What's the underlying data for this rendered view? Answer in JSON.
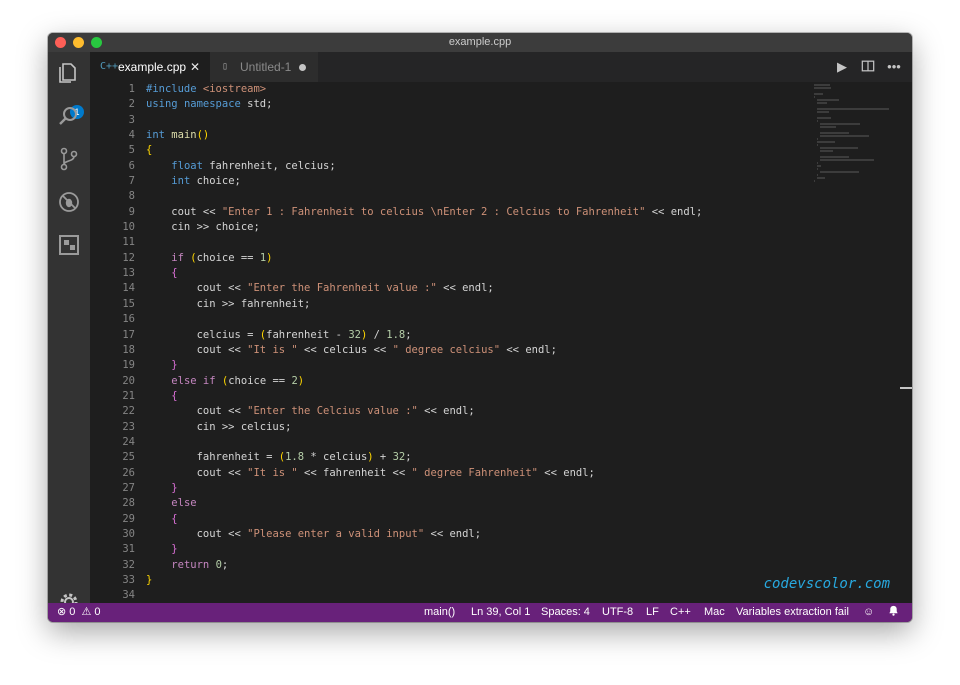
{
  "window": {
    "title": "example.cpp"
  },
  "activity_bar": {
    "explorer_badge": "1",
    "icons": [
      "files-icon",
      "search-icon",
      "source-control-icon",
      "debug-icon",
      "extensions-icon",
      "settings-gear-icon"
    ]
  },
  "tabs": [
    {
      "label": "example.cpp",
      "icon": "C++",
      "active": true,
      "close": "✕"
    },
    {
      "label": "Untitled-1",
      "icon": "▯",
      "active": false,
      "dirty": true
    }
  ],
  "editor": {
    "line_numbers": [
      "1",
      "2",
      "3",
      "4",
      "5",
      "6",
      "7",
      "8",
      "9",
      "10",
      "11",
      "12",
      "13",
      "14",
      "15",
      "16",
      "17",
      "18",
      "19",
      "20",
      "21",
      "22",
      "23",
      "24",
      "25",
      "26",
      "27",
      "28",
      "29",
      "30",
      "31",
      "32",
      "33",
      "34"
    ],
    "lines": [
      "#include <iostream>",
      "using namespace std;",
      "",
      "int main()",
      "{",
      "    float fahrenheit, celcius;",
      "    int choice;",
      "",
      "    cout << \"Enter 1 : Fahrenheit to celcius \\nEnter 2 : Celcius to Fahrenheit\" << endl;",
      "    cin >> choice;",
      "",
      "    if (choice == 1)",
      "    {",
      "        cout << \"Enter the Fahrenheit value :\" << endl;",
      "        cin >> fahrenheit;",
      "",
      "        celcius = (fahrenheit - 32) / 1.8;",
      "        cout << \"It is \" << celcius << \" degree celcius\" << endl;",
      "    }",
      "    else if (choice == 2)",
      "    {",
      "        cout << \"Enter the Celcius value :\" << endl;",
      "        cin >> celcius;",
      "",
      "        fahrenheit = (1.8 * celcius) + 32;",
      "        cout << \"It is \" << fahrenheit << \" degree Fahrenheit\" << endl;",
      "    }",
      "    else",
      "    {",
      "        cout << \"Please enter a valid input\" << endl;",
      "    }",
      "    return 0;",
      "}",
      ""
    ]
  },
  "watermark": "codevscolor.com",
  "status_bar": {
    "errors": "0",
    "warnings": "0",
    "function": "main()",
    "position": "Ln 39, Col 1",
    "spaces": "Spaces: 4",
    "encoding": "UTF-8",
    "eol": "LF",
    "language": "C++",
    "platform": "Mac",
    "message": "Variables extraction fail",
    "feedback_icon": "smiley-icon",
    "bell_icon": "bell-icon"
  },
  "colors": {
    "status_bar": "#68217a",
    "editor_bg": "#1e1e1e",
    "badge": "#007acc",
    "watermark": "#28a9e0"
  }
}
